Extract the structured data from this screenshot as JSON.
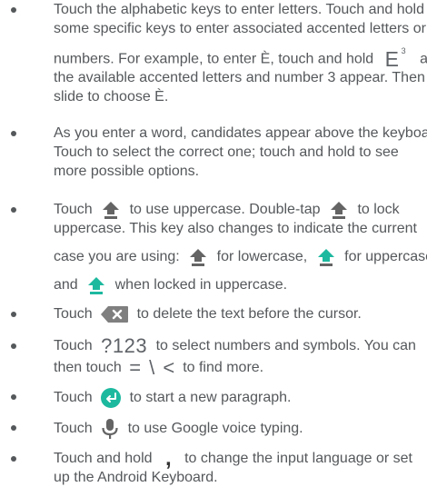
{
  "bullets": [
    {
      "l1": "Touch the alphabetic keys to enter letters. Touch and hold",
      "l2": "some specific keys to enter associated accented letters or",
      "l3a": "numbers. For example, to enter È, touch and hold",
      "l3b": "and",
      "l4": "the available accented letters and number 3 appear. Then",
      "l5": "slide to choose È.",
      "key_letter": "E",
      "key_sup": "3"
    },
    {
      "l1": "As you enter a word, candidates appear above the keyboard.",
      "l2": "Touch to select the correct one; touch and hold to see",
      "l3": "more possible options."
    },
    {
      "l1a": "Touch",
      "l1b": "to use uppercase. Double-tap",
      "l1c": "to lock",
      "l2": "uppercase. This key also changes to indicate the current",
      "l3a": "case you are using:",
      "l3b": "for lowercase,",
      "l3c": "for uppercase,",
      "l4a": "and",
      "l4b": "when locked in uppercase."
    },
    {
      "a": "Touch",
      "b": "to delete the text before the cursor."
    },
    {
      "l1a": "Touch",
      "key": "?123",
      "l1b": "to select numbers and symbols. You can",
      "l2a": "then touch",
      "symbols": "= \\ <",
      "l2b": "to find more."
    },
    {
      "a": "Touch",
      "b": "to start a new paragraph."
    },
    {
      "a": "Touch",
      "b": "to use Google voice typing."
    },
    {
      "l1a": "Touch and hold",
      "key": ",",
      "l1b": "to change the input language or set",
      "l2": "up the Android Keyboard."
    }
  ],
  "colors": {
    "text": "#55585b",
    "key_gray": "#5f6368",
    "accent": "#1db99f",
    "arrow_gray": "#646464",
    "delete_bg": "#7f7f7f"
  },
  "icons": [
    "shift-lowercase-icon",
    "shift-uppercase-icon",
    "shift-locked-icon",
    "delete-icon",
    "enter-icon",
    "microphone-icon",
    "comma-key-icon"
  ]
}
